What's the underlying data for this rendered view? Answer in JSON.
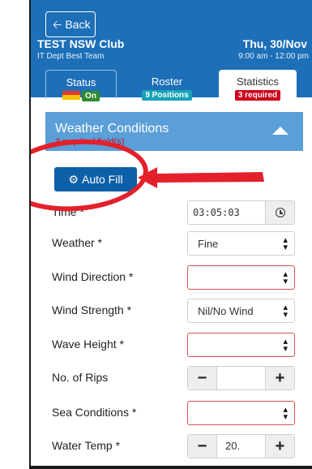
{
  "header": {
    "back_label": "Back",
    "club_name": "TEST NSW Club",
    "team_name": "IT Dept Best Team",
    "date": "Thu, 30/Nov",
    "time_range": "9:00 am - 12:00 pm"
  },
  "tabs": {
    "status": {
      "label": "Status",
      "badge": "On"
    },
    "roster": {
      "label": "Roster",
      "badge": "9 Positions"
    },
    "statistics": {
      "label": "Statistics",
      "badge": "3 required"
    }
  },
  "panel": {
    "title": "Weather Conditions",
    "subtitle": "3 required field(s)"
  },
  "autofill": {
    "label": "Auto Fill"
  },
  "fields": {
    "time": {
      "label": "Time *",
      "value": "03:05:03"
    },
    "weather": {
      "label": "Weather *",
      "value": "Fine"
    },
    "wind_direction": {
      "label": "Wind Direction *",
      "value": ""
    },
    "wind_strength": {
      "label": "Wind Strength *",
      "value": "Nil/No Wind"
    },
    "wave_height": {
      "label": "Wave Height *",
      "value": ""
    },
    "rips": {
      "label": "No. of Rips",
      "value": ""
    },
    "sea_conditions": {
      "label": "Sea Conditions *",
      "value": ""
    },
    "water_temp": {
      "label": "Water Temp *",
      "value": "20."
    }
  },
  "colors": {
    "header_bg": "#1d6fb8",
    "panel_bg": "#5b9fd8",
    "primary_button": "#0d5fa8",
    "required_red": "#d0021b",
    "annotation_red": "#e4212b"
  },
  "icons": {
    "back": "arrow-left-icon",
    "autofill": "cog-icon",
    "time": "clock-icon",
    "select": "chevron-updown-icon",
    "collapse": "caret-up-icon"
  }
}
